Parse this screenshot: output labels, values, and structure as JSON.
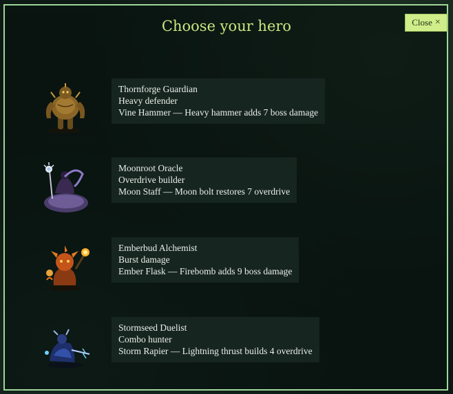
{
  "dialog": {
    "title": "Choose your hero",
    "close_label": "Close",
    "close_icon": "×"
  },
  "heroes": [
    {
      "name": "Thornforge Guardian",
      "role": "Heavy defender",
      "ability": "Vine Hammer — Heavy hammer adds 7 boss damage",
      "portrait_icon": "thornforge-guardian-portrait-icon"
    },
    {
      "name": "Moonroot Oracle",
      "role": "Overdrive builder",
      "ability": "Moon Staff — Moon bolt restores 7 overdrive",
      "portrait_icon": "moonroot-oracle-portrait-icon"
    },
    {
      "name": "Emberbud Alchemist",
      "role": "Burst damage",
      "ability": "Ember Flask — Firebomb adds 9 boss damage",
      "portrait_icon": "emberbud-alchemist-portrait-icon"
    },
    {
      "name": "Stormseed Duelist",
      "role": "Combo hunter",
      "ability": "Storm Rapier — Lightning thrust builds 4 overdrive",
      "portrait_icon": "stormseed-duelist-portrait-icon"
    }
  ],
  "colors": {
    "accent": "#c9e87f",
    "close_button_bg": "#cfee8a",
    "frame_border": "#9fd89a",
    "card_bg": "#1a2823"
  }
}
